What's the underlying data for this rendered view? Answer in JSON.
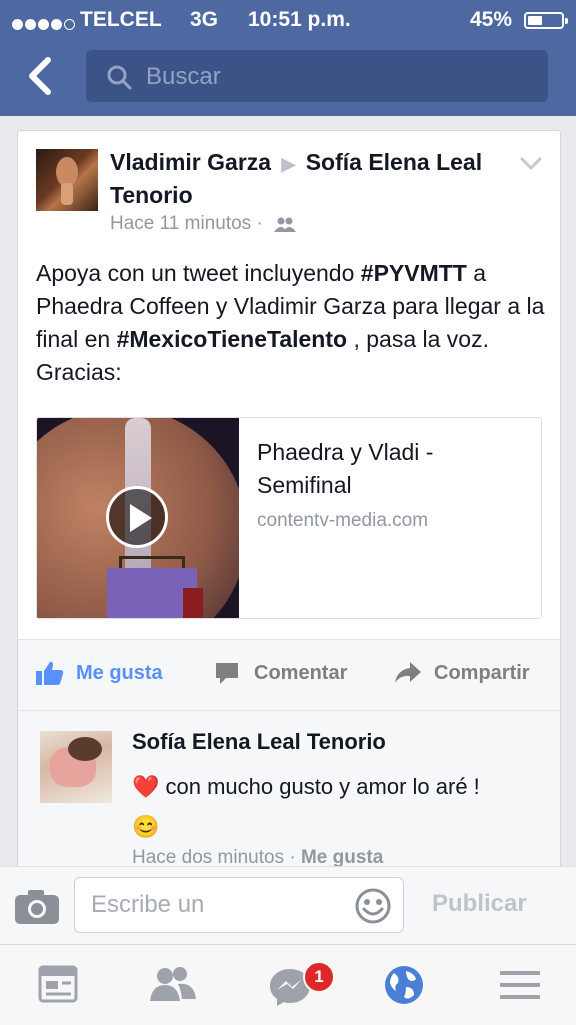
{
  "status_bar": {
    "carrier": "TELCEL",
    "network": "3G",
    "time": "10:51 p.m.",
    "battery_percent": "45%",
    "battery_level": 0.45,
    "signal_bars": 4
  },
  "header": {
    "back_icon": "chevron-left-icon",
    "search_placeholder": "Buscar"
  },
  "post": {
    "author": "Vladimir Garza",
    "target": "Sofía Elena Leal Tenorio",
    "time": "Hace 11 minutos",
    "separator": "·",
    "text_parts": {
      "p1": "Apoya con un tweet incluyendo ",
      "hashtag1": "#PYVMTT",
      "p2": " a Phaedra Coffeen y Vladimir Garza para llegar a la final en ",
      "hashtag2": "#MexicoTieneTalento",
      "p3": " , pasa la voz. Gracias:"
    },
    "link": {
      "title": "Phaedra y Vladi - Semifinal",
      "domain": "contentv-media.com"
    },
    "actions": {
      "like": "Me gusta",
      "comment": "Comentar",
      "share": "Compartir"
    }
  },
  "comment": {
    "author": "Sofía Elena Leal Tenorio",
    "heart": "❤️",
    "text": " con mucho gusto y amor lo aré !",
    "emoji": "😊",
    "time": "Hace dos minutos",
    "separator": "·",
    "like": "Me gusta"
  },
  "composer": {
    "placeholder": "Escribe un",
    "publish_label": "Publicar"
  },
  "tabbar": {
    "messages_badge": "1"
  },
  "colors": {
    "facebook_blue": "#4e69a2",
    "search_bg": "#3b5386",
    "like_blue": "#5890ff",
    "badge_red": "#e02727"
  }
}
